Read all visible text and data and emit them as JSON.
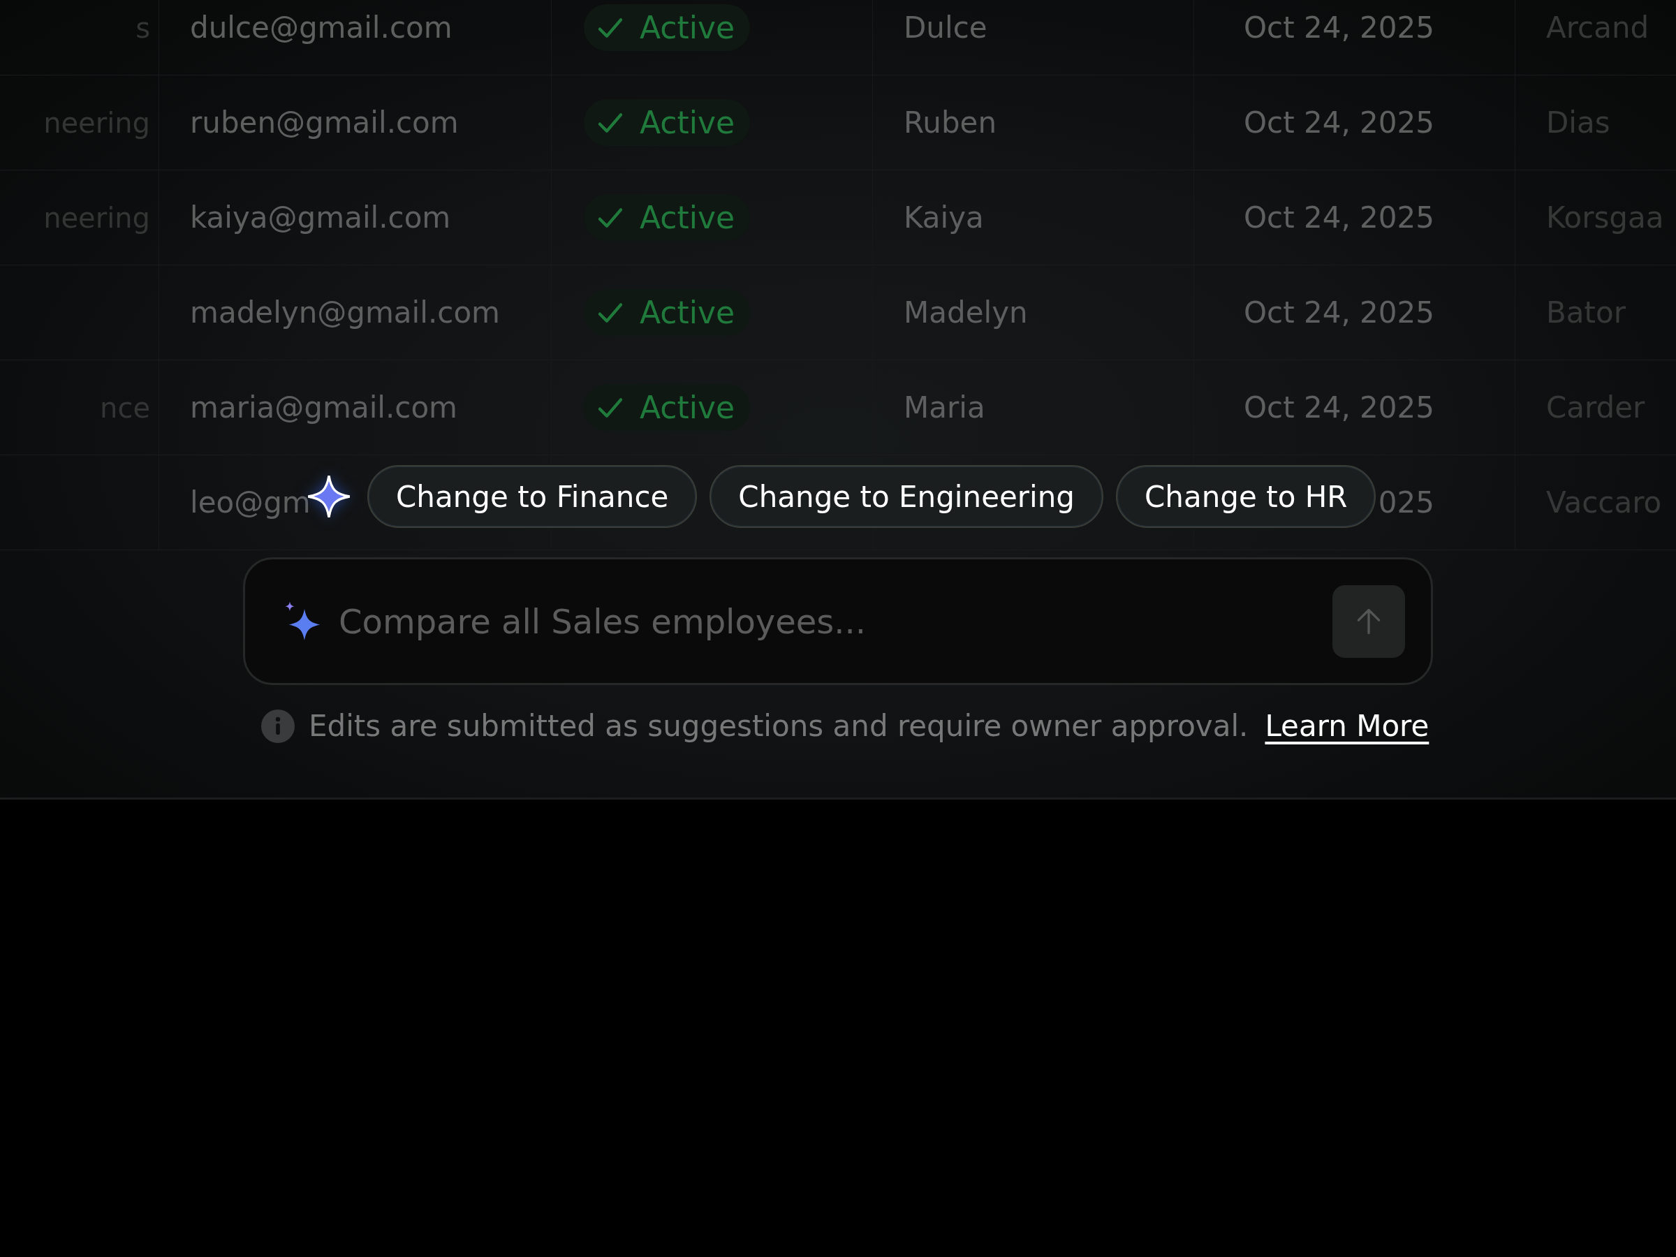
{
  "table": {
    "rows": [
      {
        "department": "s",
        "email": "dulce@gmail.com",
        "status": {
          "kind": "active",
          "label": "Active"
        },
        "first_name": "Dulce",
        "date": "Oct 24, 2025",
        "last_name": "Arcand"
      },
      {
        "department": "neering",
        "email": "ruben@gmail.com",
        "status": {
          "kind": "active",
          "label": "Active"
        },
        "first_name": "Ruben",
        "date": "Oct 24, 2025",
        "last_name": "Dias"
      },
      {
        "department": "neering",
        "email": "kaiya@gmail.com",
        "status": {
          "kind": "active",
          "label": "Active"
        },
        "first_name": "Kaiya",
        "date": "Oct 24, 2025",
        "last_name": "Korsgaa"
      },
      {
        "email": "madelyn@gmail.com",
        "status": {
          "kind": "active",
          "label": "Active"
        },
        "first_name": "Madelyn",
        "date": "Oct 24, 2025",
        "last_name": "Bator"
      },
      {
        "department": "nce",
        "email": "maria@gmail.com",
        "status": {
          "kind": "active",
          "label": "Active"
        },
        "first_name": "Maria",
        "date": "Oct 24, 2025",
        "last_name": "Carder"
      },
      {
        "email": "leo@gm",
        "date": "025",
        "last_name": "Vaccaro"
      }
    ]
  },
  "suggestions": [
    "Change to Finance",
    "Change to Engineering",
    "Change to HR"
  ],
  "prompt": {
    "placeholder": "Compare all Sales employees..."
  },
  "notice": {
    "text": "Edits are submitted as suggestions and require owner approval.",
    "link": "Learn More"
  }
}
